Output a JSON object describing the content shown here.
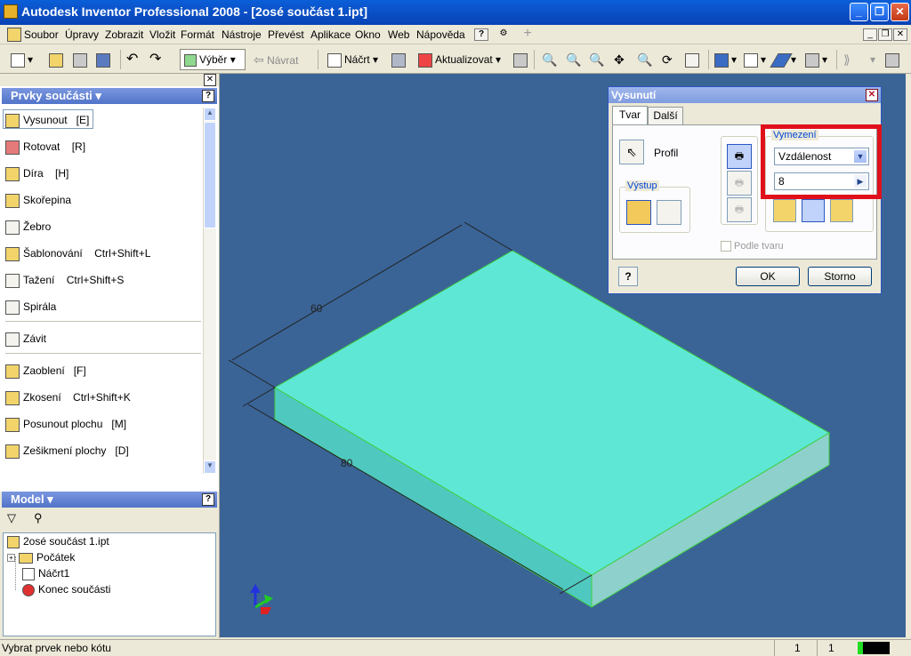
{
  "window": {
    "title": "Autodesk Inventor Professional 2008 - [2osé součást 1.ipt]",
    "min": "_",
    "restore": "❐",
    "close": "✕"
  },
  "menu": [
    "Soubor",
    "Úpravy",
    "Zobrazit",
    "Vložit",
    "Formát",
    "Nástroje",
    "Převést",
    "Aplikace",
    "Okno",
    "Web",
    "Nápověda"
  ],
  "menu_help_icon": "?",
  "toolbar": {
    "select": "Výběr",
    "back": "Návrat",
    "sketch": "Náčrt",
    "update": "Aktualizovat"
  },
  "features_panel": {
    "title": "Prvky součásti",
    "help": "?",
    "items": [
      {
        "label": "Vysunout",
        "shortcut": "[E]",
        "icon": "extrude-icon"
      },
      {
        "label": "Rotovat",
        "shortcut": "[R]",
        "icon": "revolve-icon"
      },
      {
        "label": "Díra",
        "shortcut": "[H]",
        "icon": "hole-icon"
      },
      {
        "label": "Skořepina",
        "shortcut": "",
        "icon": "shell-icon"
      },
      {
        "label": "Žebro",
        "shortcut": "",
        "icon": "rib-icon"
      },
      {
        "label": "Šablonování",
        "shortcut": "Ctrl+Shift+L",
        "icon": "loft-icon"
      },
      {
        "label": "Tažení",
        "shortcut": "Ctrl+Shift+S",
        "icon": "sweep-icon"
      },
      {
        "label": "Spirála",
        "shortcut": "",
        "icon": "coil-icon"
      },
      {
        "label": "Závit",
        "shortcut": "",
        "icon": "thread-icon"
      },
      {
        "label": "Zaoblení",
        "shortcut": "[F]",
        "icon": "fillet-icon"
      },
      {
        "label": "Zkosení",
        "shortcut": "Ctrl+Shift+K",
        "icon": "chamfer-icon"
      },
      {
        "label": "Posunout plochu",
        "shortcut": "[M]",
        "icon": "move-face-icon"
      },
      {
        "label": "Zešikmení plochy",
        "shortcut": "[D]",
        "icon": "face-draft-icon"
      }
    ]
  },
  "model_panel": {
    "title": "Model",
    "help": "?",
    "tree": [
      {
        "label": "2osé součást 1.ipt",
        "icon": "part-icon"
      },
      {
        "label": "Počátek",
        "icon": "folder-icon"
      },
      {
        "label": "Náčrt1",
        "icon": "sketch-icon"
      },
      {
        "label": "Konec součásti",
        "icon": "end-of-part-icon"
      }
    ]
  },
  "viewport": {
    "dim_width": "60",
    "dim_length": "80",
    "box_color": "#5fe7d6",
    "background": "#3a6496"
  },
  "dialog": {
    "title": "Vysunutí",
    "close": "✕",
    "tabs": [
      "Tvar",
      "Další"
    ],
    "profile_label": "Profil",
    "output_label": "Výstup",
    "extents_label": "Vymezení",
    "extents_value": "Vzdálenost",
    "distance_value": "8",
    "match_shape": "Podle tvaru",
    "help": "?",
    "ok": "OK",
    "cancel": "Storno",
    "highlight_color": "#e0101a"
  },
  "status": {
    "text": "Vybrat prvek nebo kótu",
    "n1": "1",
    "n2": "1"
  }
}
